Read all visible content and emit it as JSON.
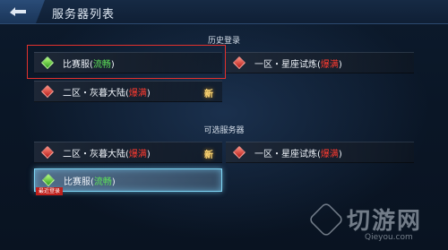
{
  "header": {
    "title": "服务器列表"
  },
  "history": {
    "title": "历史登录",
    "items": [
      {
        "prefix": "比赛服(",
        "status": "流畅",
        "suffix": ")",
        "status_color": "green",
        "gem": "green",
        "badge": ""
      },
      {
        "prefix": "一区・星座试炼(",
        "status": "爆满",
        "suffix": ")",
        "status_color": "red",
        "gem": "red",
        "badge": ""
      },
      {
        "prefix": "二区・灰暮大陆(",
        "status": "爆满",
        "suffix": ")",
        "status_color": "red",
        "gem": "red",
        "badge": "新"
      }
    ]
  },
  "available": {
    "title": "可选服务器",
    "items": [
      {
        "prefix": "二区・灰暮大陆(",
        "status": "爆满",
        "suffix": ")",
        "status_color": "red",
        "gem": "red",
        "badge": "新"
      },
      {
        "prefix": "一区・星座试炼(",
        "status": "爆满",
        "suffix": ")",
        "status_color": "red",
        "gem": "red",
        "badge": ""
      },
      {
        "prefix": "比赛服(",
        "status": "流畅",
        "suffix": ")",
        "status_color": "green",
        "gem": "green",
        "badge": "",
        "tag": "最近登录"
      }
    ]
  },
  "watermark": {
    "text": "切游网",
    "url": "Qieyou.com"
  },
  "colors": {
    "highlight_frame": "#e3312d",
    "selected_border": "#7fd6f5",
    "status_green": "#5fe65a",
    "status_red": "#ff3b30",
    "badge": "#ffd977"
  }
}
